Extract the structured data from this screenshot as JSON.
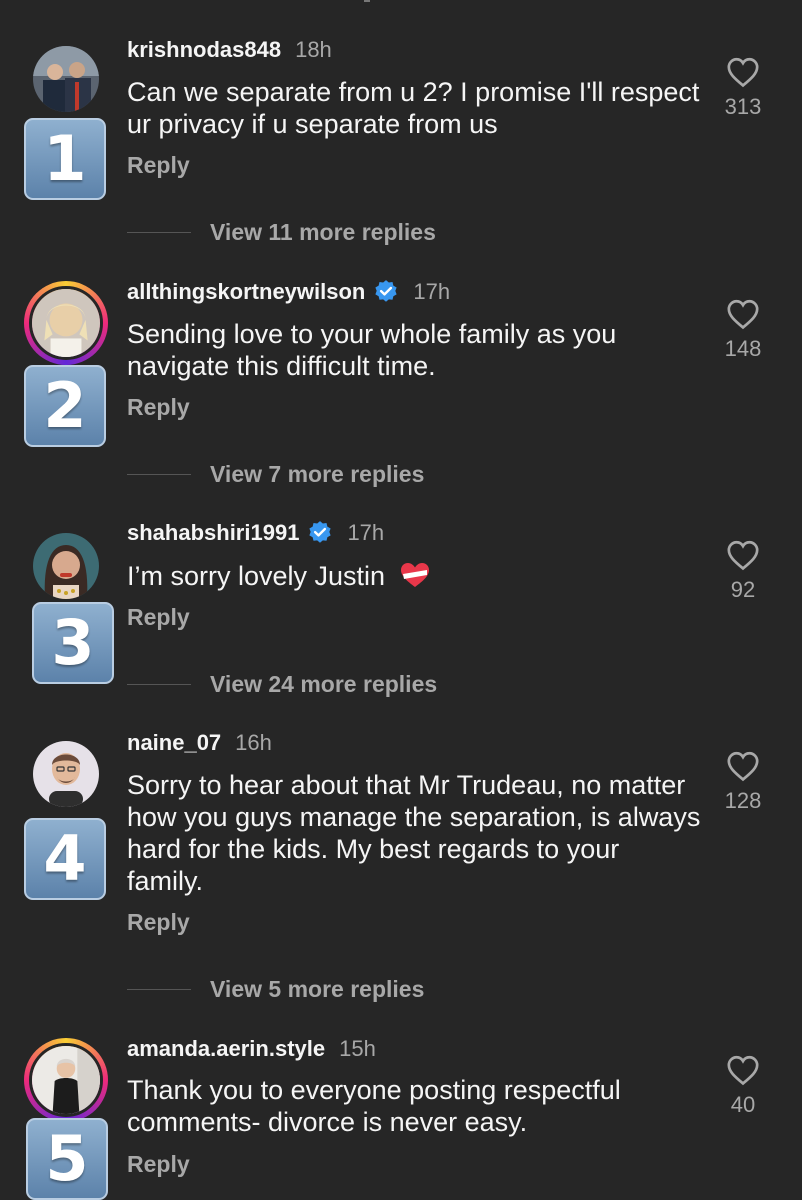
{
  "comments": [
    {
      "username": "krishnodas848",
      "time": "18h",
      "verified": false,
      "text": "Can we separate from u 2? I promise I'll respect ur privacy if u separate from us",
      "reply_label": "Reply",
      "likes": "313",
      "rank": "1",
      "view_replies": "View 11 more replies"
    },
    {
      "username": "allthingskortneywilson",
      "time": "17h",
      "verified": true,
      "text": "Sending love to your whole family as you navigate this difficult time.",
      "reply_label": "Reply",
      "likes": "148",
      "rank": "2",
      "view_replies": "View 7 more replies"
    },
    {
      "username": "shahabshiri1991",
      "time": "17h",
      "verified": true,
      "text": "I’m sorry lovely Justin",
      "reply_label": "Reply",
      "likes": "92",
      "rank": "3",
      "view_replies": "View 24 more replies"
    },
    {
      "username": "naine_07",
      "time": "16h",
      "verified": false,
      "text": "Sorry to hear about that Mr Trudeau, no matter how you guys manage the separation, is always hard for the kids.  My best regards to your family.",
      "reply_label": "Reply",
      "likes": "128",
      "rank": "4",
      "view_replies": "View 5 more replies"
    },
    {
      "username": "amanda.aerin.style",
      "time": "15h",
      "verified": false,
      "text": "Thank you to everyone posting respectful comments- divorce is never easy.",
      "reply_label": "Reply",
      "likes": "40",
      "rank": "5"
    }
  ],
  "colors": {
    "background": "#262626",
    "primary_text": "#f5f5f5",
    "secondary_text": "#a8a8a8",
    "verified_badge": "#3897f0",
    "rank_badge": "#6f93bb"
  },
  "icons": {
    "like": "heart-outline-icon",
    "verified": "verified-badge-icon",
    "emoji": "heart-with-ribbon-emoji"
  }
}
